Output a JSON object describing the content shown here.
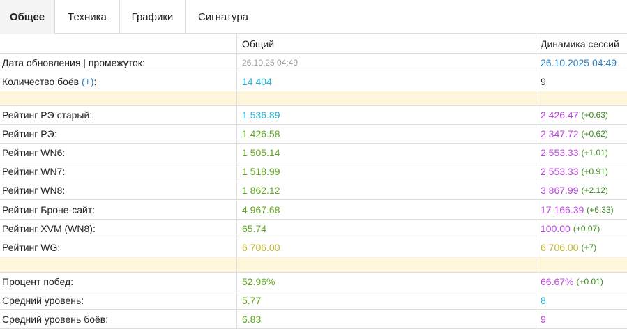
{
  "tabs": [
    {
      "label": "Общее",
      "active": true
    },
    {
      "label": "Техника",
      "active": false
    },
    {
      "label": "Графики",
      "active": false
    },
    {
      "label": "Сигнатура",
      "active": false
    }
  ],
  "header": {
    "col1": "",
    "col2": "Общий",
    "col3": "Динамика сессий"
  },
  "info": {
    "update": {
      "label": "Дата обновления | промежуток:",
      "general": "26.10.25 04:49",
      "session": "26.10.2025 04:49"
    },
    "battles": {
      "label": "Количество боёв",
      "plus": "(+)",
      "colon": ":",
      "general": "14 404",
      "session": "9"
    }
  },
  "ratings": [
    {
      "label": "Рейтинг РЭ старый:",
      "general": "1 536.89",
      "session": "2 426.47",
      "delta": "(+0.63)"
    },
    {
      "label": "Рейтинг РЭ:",
      "general": "1 426.58",
      "session": "2 347.72",
      "delta": "(+0.62)"
    },
    {
      "label": "Рейтинг WN6:",
      "general": "1 505.14",
      "session": "2 553.33",
      "delta": "(+1.01)"
    },
    {
      "label": "Рейтинг WN7:",
      "general": "1 518.99",
      "session": "2 553.33",
      "delta": "(+0.91)"
    },
    {
      "label": "Рейтинг WN8:",
      "general": "1 862.12",
      "session": "3 867.99",
      "delta": "(+2.12)"
    },
    {
      "label": "Рейтинг Броне-сайт:",
      "general": "4 967.68",
      "session": "17 166.39",
      "delta": "(+6.33)"
    },
    {
      "label": "Рейтинг XVM (WN8):",
      "general": "65.74",
      "session": "100.00",
      "delta": "(+0.07)"
    },
    {
      "label": "Рейтинг WG:",
      "general": "6 706.00",
      "session": "6 706.00",
      "delta": "(+7)"
    }
  ],
  "stats": [
    {
      "label": "Процент побед:",
      "general": "52.96%",
      "session": "66.67%",
      "delta": "(+0.01)"
    },
    {
      "label": "Средний уровень:",
      "general": "5.77",
      "session": "8",
      "delta": ""
    },
    {
      "label": "Средний уровень боёв:",
      "general": "6.83",
      "session": "9",
      "delta": ""
    }
  ],
  "colors": {
    "text": "#222222",
    "muted": "#9a9a9a",
    "link": "#2a7fc1",
    "cyan": "#22b4d6",
    "green": "#5fa61e",
    "olive": "#c4b432",
    "purple": "#bd49e2",
    "delta": "#3d8b1d",
    "separator": "#fef7dc",
    "border": "#dddddd"
  },
  "value_colors": {
    "ratings_general": [
      "cyan",
      "green",
      "green",
      "green",
      "green",
      "green",
      "green",
      "olive"
    ],
    "ratings_session": [
      "purple",
      "purple",
      "purple",
      "purple",
      "purple",
      "purple",
      "purple",
      "olive"
    ],
    "stats_general": [
      "green",
      "green",
      "green"
    ],
    "stats_session": [
      "purple",
      "cyan",
      "purple"
    ]
  }
}
